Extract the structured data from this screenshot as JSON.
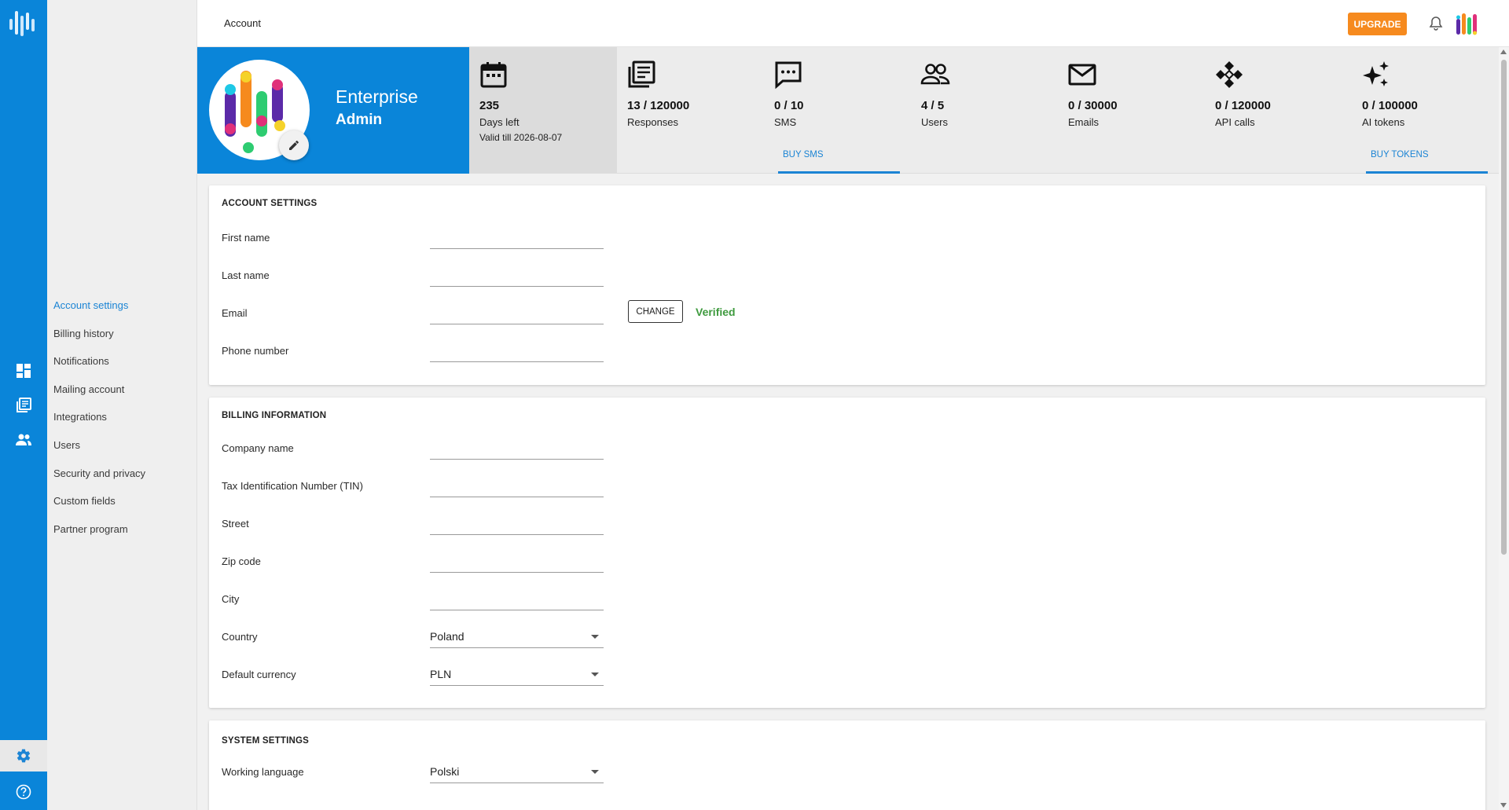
{
  "topbar": {
    "title": "Account",
    "upgrade_label": "UPGRADE",
    "bell_icon": "bell-icon",
    "logo_icon": "app-logo"
  },
  "rail": {
    "items": [
      "dashboard-icon",
      "surveys-icon",
      "users-icon"
    ],
    "bottom": [
      "settings-icon",
      "help-icon"
    ]
  },
  "submenu": {
    "items": [
      {
        "label": "Account settings",
        "active": true
      },
      {
        "label": "Billing history"
      },
      {
        "label": "Notifications"
      },
      {
        "label": "Mailing account"
      },
      {
        "label": "Integrations"
      },
      {
        "label": "Users"
      },
      {
        "label": "Security and privacy"
      },
      {
        "label": "Custom fields"
      },
      {
        "label": "Partner program"
      }
    ]
  },
  "plan": {
    "name": "Enterprise",
    "role": "Admin"
  },
  "stats": {
    "days": {
      "value": "235",
      "label": "Days left",
      "sub": "Valid till 2026-08-07",
      "icon": "calendar-icon"
    },
    "responses": {
      "value": "13 / 120000",
      "label": "Responses",
      "icon": "responses-icon"
    },
    "sms": {
      "value": "0 / 10",
      "label": "SMS",
      "icon": "sms-icon",
      "buy": "BUY SMS"
    },
    "users": {
      "value": "4 / 5",
      "label": "Users",
      "icon": "users-icon"
    },
    "emails": {
      "value": "0 / 30000",
      "label": "Emails",
      "icon": "mail-icon"
    },
    "api": {
      "value": "0 / 120000",
      "label": "API calls",
      "icon": "api-icon"
    },
    "ai": {
      "value": "0 / 100000",
      "label": "AI tokens",
      "icon": "sparkles-icon",
      "buy": "BUY TOKENS"
    }
  },
  "account_settings": {
    "heading": "ACCOUNT SETTINGS",
    "first_name": {
      "label": "First name",
      "value": ""
    },
    "last_name": {
      "label": "Last name",
      "value": ""
    },
    "email": {
      "label": "Email",
      "value": "",
      "change_label": "CHANGE",
      "status": "Verified"
    },
    "phone": {
      "label": "Phone number",
      "value": ""
    }
  },
  "billing": {
    "heading": "BILLING INFORMATION",
    "company": {
      "label": "Company name",
      "value": ""
    },
    "tin": {
      "label": "Tax Identification Number (TIN)",
      "value": ""
    },
    "street": {
      "label": "Street",
      "value": ""
    },
    "zip": {
      "label": "Zip code",
      "value": ""
    },
    "city": {
      "label": "City",
      "value": ""
    },
    "country": {
      "label": "Country",
      "value": "Poland"
    },
    "currency": {
      "label": "Default currency",
      "value": "PLN"
    }
  },
  "system": {
    "heading": "SYSTEM SETTINGS",
    "language": {
      "label": "Working language",
      "value": "Polski"
    }
  },
  "colors": {
    "primary": "#0a85d9",
    "accent": "#1b84d4",
    "upgrade": "#f68a1e",
    "verified": "#3e9a3e"
  }
}
